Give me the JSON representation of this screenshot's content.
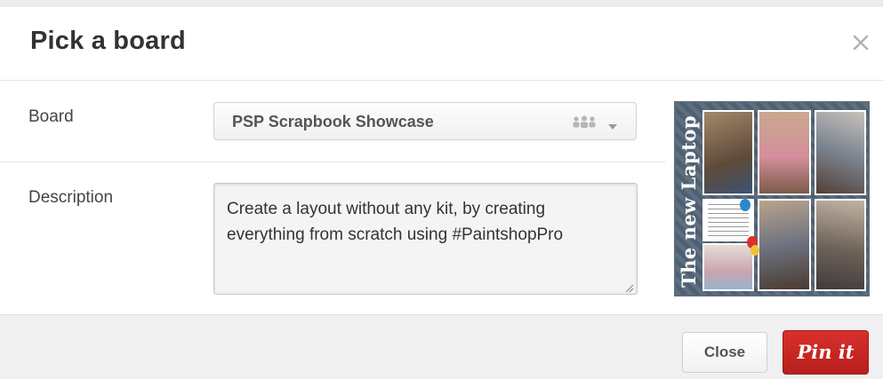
{
  "dialog": {
    "title": "Pick a board",
    "close_icon": "close-x-icon"
  },
  "board": {
    "label": "Board",
    "selected": "PSP Scrapbook Showcase",
    "group_icon": "group-board-icon",
    "caret_icon": "chevron-down-icon"
  },
  "description": {
    "label": "Description",
    "value": "Create a layout without any kit, by creating everything from scratch using #PaintshopPro"
  },
  "preview": {
    "title_text": "The new Laptop"
  },
  "footer": {
    "close_label": "Close",
    "pin_label": "Pin it"
  },
  "colors": {
    "pin_button": "#cb2027",
    "footer_bg": "#f0f0f0"
  }
}
